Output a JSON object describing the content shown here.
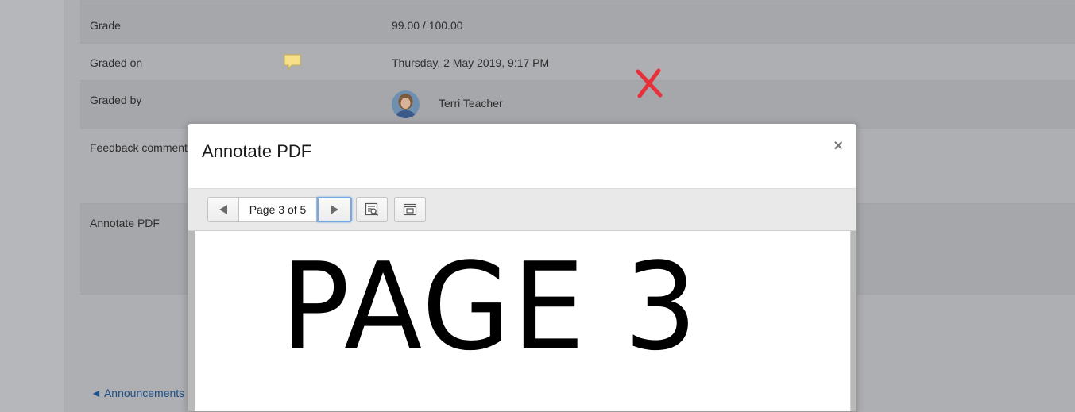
{
  "background": {
    "rows": [
      {
        "label": "Grade",
        "value": "99.00 / 100.00"
      },
      {
        "label": "Graded on",
        "value": "Thursday, 2 May 2019, 9:17 PM"
      },
      {
        "label": "Graded by",
        "value": "Terri Teacher"
      },
      {
        "label": "Feedback comments",
        "value": ""
      },
      {
        "label": "Annotate PDF",
        "value": ""
      }
    ],
    "nav_link": "◄ Announcements"
  },
  "modal": {
    "title": "Annotate PDF",
    "close_glyph": "×",
    "toolbar": {
      "prev_glyph": "◀",
      "page_label": "Page 3 of 5",
      "next_glyph": "▶"
    },
    "pdf_page_text": "PAGE 3"
  },
  "colors": {
    "overlay_bg": "#aeafb3",
    "link": "#1d4f86",
    "error_mark": "#e8303a",
    "comment_icon": "#f7e08a",
    "focus_ring": "#7aa7e0"
  }
}
